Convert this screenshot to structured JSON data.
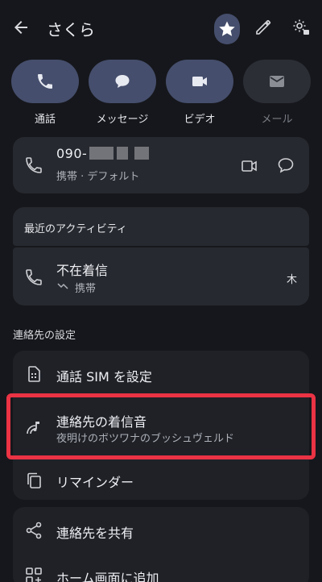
{
  "header": {
    "title": "さくら"
  },
  "actions": [
    {
      "label": "通話",
      "icon": "phone-icon"
    },
    {
      "label": "メッセージ",
      "icon": "chat-icon"
    },
    {
      "label": "ビデオ",
      "icon": "video-icon"
    },
    {
      "label": "メール",
      "icon": "mail-icon",
      "disabled": true
    }
  ],
  "phone": {
    "number_prefix": "090-",
    "subtitle": "携帯 · デフォルト"
  },
  "recent": {
    "title": "最近のアクティビティ",
    "call_title": "不在着信",
    "call_sub": "携帯",
    "call_day": "木"
  },
  "settings": {
    "section_title": "連絡先の設定",
    "sim_label": "通話 SIM を設定",
    "ringtone_label": "連絡先の着信音",
    "ringtone_value": "夜明けのボツワナのブッシュヴェルド",
    "reminder_label": "リマインダー",
    "share_label": "連絡先を共有",
    "home_label": "ホーム画面に追加"
  },
  "colors": {
    "background": "#16171c",
    "card": "#26292f",
    "accent_button": "#454e6c",
    "highlight": "#ea3344"
  }
}
